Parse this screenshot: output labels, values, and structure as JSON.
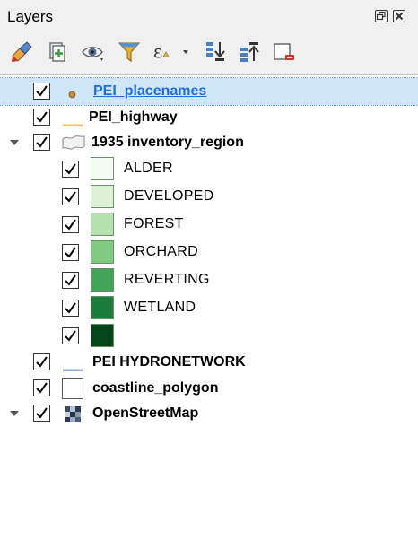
{
  "panel": {
    "title": "Layers"
  },
  "toolbar": {
    "buttons": [
      {
        "name": "style-paint-icon"
      },
      {
        "name": "add-group-icon"
      },
      {
        "name": "eye-visibility-icon"
      },
      {
        "name": "filter-funnel-icon"
      },
      {
        "name": "expression-filter-icon"
      },
      {
        "name": "expand-all-icon"
      },
      {
        "name": "collapse-all-icon"
      },
      {
        "name": "remove-layer-icon"
      }
    ]
  },
  "layers": [
    {
      "label": "PEI_placenames",
      "checked": true,
      "selected": true,
      "symbol": "point",
      "color": "#c58a3a"
    },
    {
      "label": "PEI_highway",
      "checked": true,
      "selected": false,
      "symbol": "line",
      "color": "#f0c060"
    },
    {
      "label": "1935 inventory_region",
      "checked": true,
      "selected": false,
      "symbol": "polygon-group",
      "expanded": true,
      "classes": [
        {
          "label": "ALDER",
          "color": "#f4fbf1"
        },
        {
          "label": "DEVELOPED",
          "color": "#dcf1d6"
        },
        {
          "label": "FOREST",
          "color": "#b5e1ae"
        },
        {
          "label": "ORCHARD",
          "color": "#7fca7f"
        },
        {
          "label": "REVERTING",
          "color": "#43a55a"
        },
        {
          "label": "WETLAND",
          "color": "#1b7d3c"
        },
        {
          "label": "",
          "color": "#04451a"
        }
      ]
    },
    {
      "label": "PEI HYDRONETWORK",
      "checked": true,
      "selected": false,
      "symbol": "line",
      "color": "#99aed6"
    },
    {
      "label": "coastline_polygon",
      "checked": true,
      "selected": false,
      "symbol": "polygon",
      "color": "#ffffff"
    },
    {
      "label": "OpenStreetMap",
      "checked": true,
      "selected": false,
      "symbol": "raster",
      "expanded": true
    }
  ]
}
